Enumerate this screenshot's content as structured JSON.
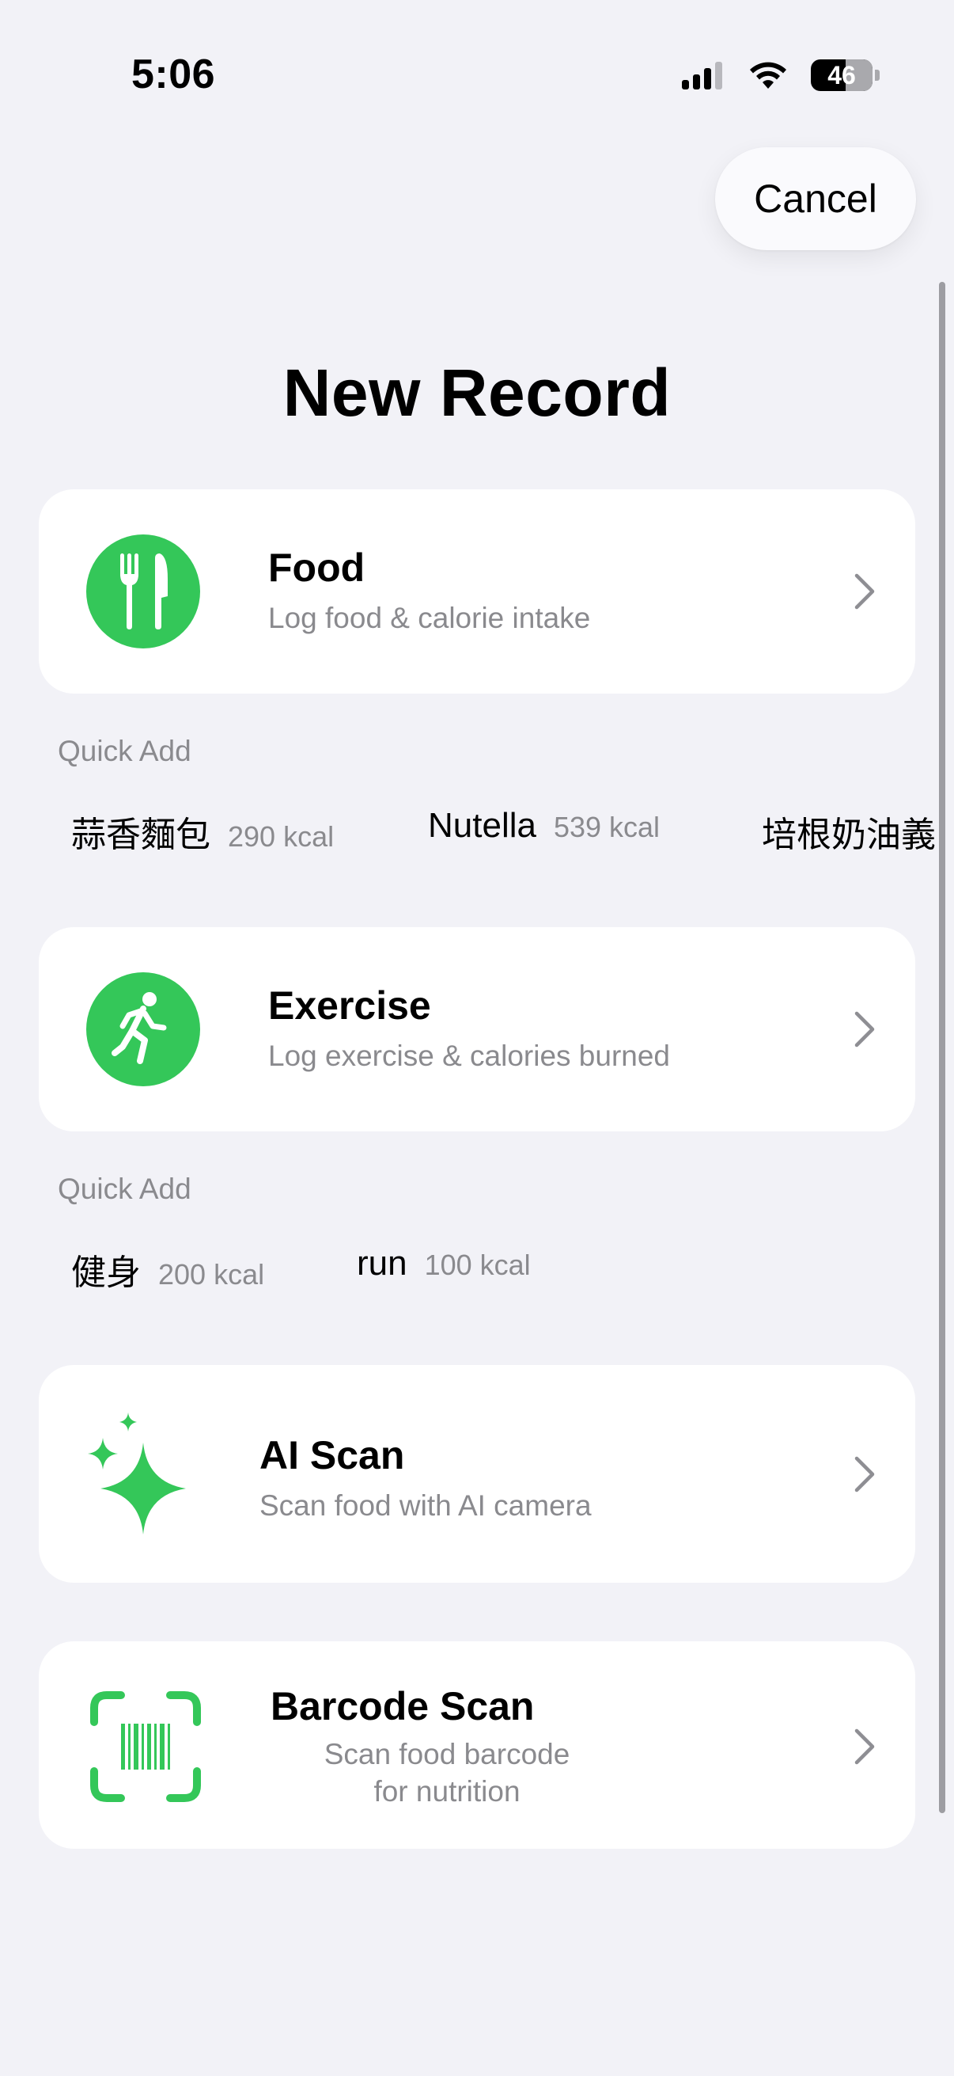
{
  "status_bar": {
    "time": "5:06",
    "battery_level": "46",
    "battery_fraction": 0.56
  },
  "header": {
    "cancel_label": "Cancel",
    "title": "New Record"
  },
  "colors": {
    "accent_green": "#34C759",
    "secondary_text": "#8A8A8E",
    "background": "#F2F2F7"
  },
  "food": {
    "icon": "fork-knife-icon",
    "title": "Food",
    "subtitle": "Log food & calorie intake",
    "quick_add_label": "Quick Add",
    "quick_add": [
      {
        "name": "蒜香麵包",
        "kcal": "290 kcal"
      },
      {
        "name": "Nutella",
        "kcal": "539 kcal"
      },
      {
        "name": "培根奶油義",
        "kcal": ""
      }
    ]
  },
  "exercise": {
    "icon": "running-person-icon",
    "title": "Exercise",
    "subtitle": "Log exercise & calories burned",
    "quick_add_label": "Quick Add",
    "quick_add": [
      {
        "name": "健身",
        "kcal": "200 kcal"
      },
      {
        "name": "run",
        "kcal": "100 kcal"
      }
    ]
  },
  "ai_scan": {
    "icon": "sparkles-icon",
    "title": "AI Scan",
    "subtitle": "Scan food with AI camera"
  },
  "barcode_scan": {
    "icon": "barcode-viewfinder-icon",
    "title": "Barcode Scan",
    "subtitle_line1": "Scan food barcode",
    "subtitle_line2": "for nutrition"
  }
}
